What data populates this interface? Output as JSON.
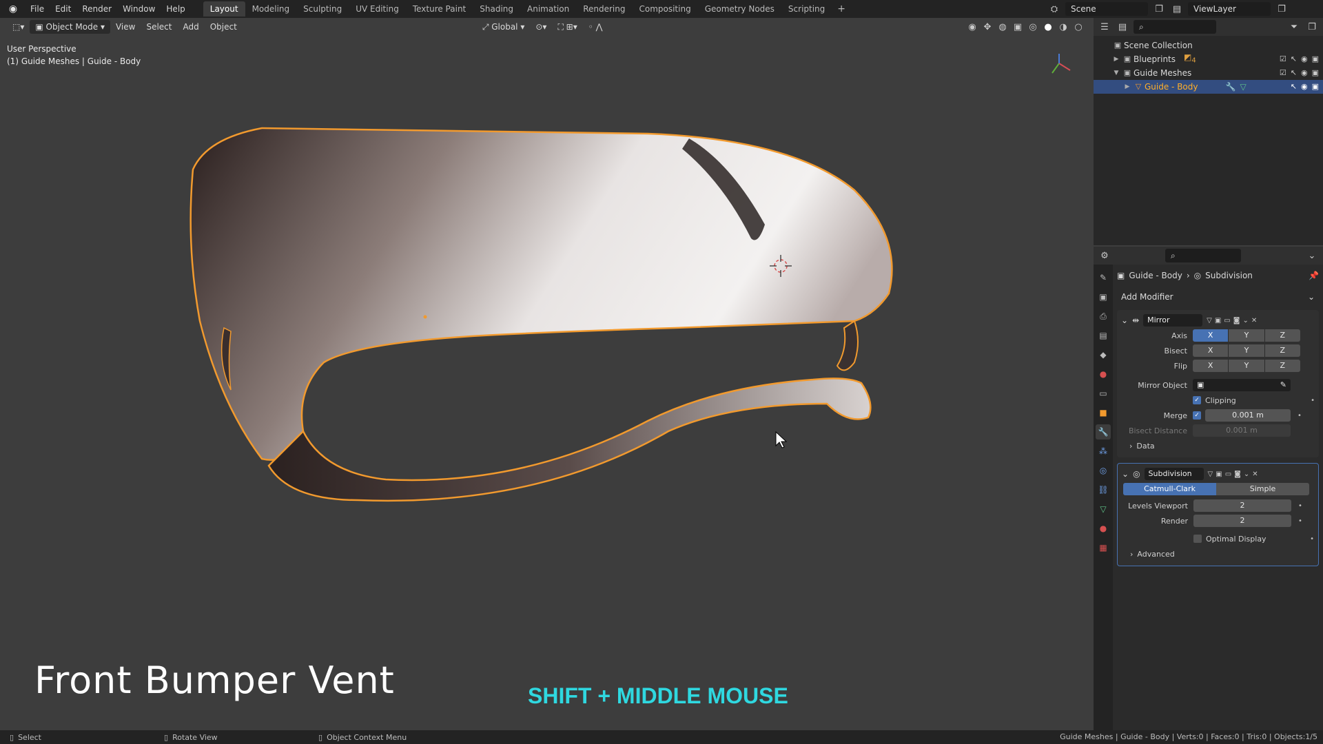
{
  "topbar": {
    "menus": [
      "File",
      "Edit",
      "Render",
      "Window",
      "Help"
    ],
    "workspaces": [
      "Layout",
      "Modeling",
      "Sculpting",
      "UV Editing",
      "Texture Paint",
      "Shading",
      "Animation",
      "Rendering",
      "Compositing",
      "Geometry Nodes",
      "Scripting"
    ],
    "active_workspace": "Layout",
    "add_tab": "+",
    "scene": "Scene",
    "view_layer": "ViewLayer"
  },
  "viewport": {
    "mode": "Object Mode",
    "menus": [
      "View",
      "Select",
      "Add",
      "Object"
    ],
    "transform_orientation": "Global",
    "perspective_label": "User Perspective",
    "collection_label": "(1) Guide Meshes | Guide - Body"
  },
  "overlay": {
    "title": "Front Bumper Vent",
    "keys": "SHIFT + MIDDLE MOUSE",
    "keys_color": "#2fd8e0"
  },
  "outliner": {
    "rows": [
      {
        "label": "Scene Collection"
      },
      {
        "label": "Blueprints"
      },
      {
        "label": "Guide Meshes"
      },
      {
        "label": "Guide - Body"
      }
    ],
    "blueprints_count": "4"
  },
  "properties": {
    "breadcrumb_object": "Guide - Body",
    "breadcrumb_modifier": "Subdivision",
    "add_modifier": "Add Modifier",
    "mirror": {
      "name": "Mirror",
      "axis_label": "Axis",
      "bisect_label": "Bisect",
      "flip_label": "Flip",
      "x": "X",
      "y": "Y",
      "z": "Z",
      "mirror_object_label": "Mirror Object",
      "clipping_label": "Clipping",
      "merge_label": "Merge",
      "merge_value": "0.001 m",
      "bisect_distance_label": "Bisect Distance",
      "bisect_distance_value": "0.001 m",
      "data_label": "Data"
    },
    "subdivision": {
      "name": "Subdivision",
      "catmull": "Catmull-Clark",
      "simple": "Simple",
      "levels_viewport_label": "Levels Viewport",
      "levels_viewport_value": "2",
      "render_label": "Render",
      "render_value": "2",
      "optimal_display_label": "Optimal Display",
      "advanced_label": "Advanced"
    }
  },
  "statusbar": {
    "select": "Select",
    "rotate": "Rotate View",
    "context": "Object Context Menu",
    "stats": "Guide Meshes | Guide - Body | Verts:0 | Faces:0 | Tris:0 | Objects:1/5"
  },
  "colors": {
    "selection_outline": "#f29a2e",
    "accent_blue": "#4772b3",
    "active_object_text": "#ffaf29"
  }
}
